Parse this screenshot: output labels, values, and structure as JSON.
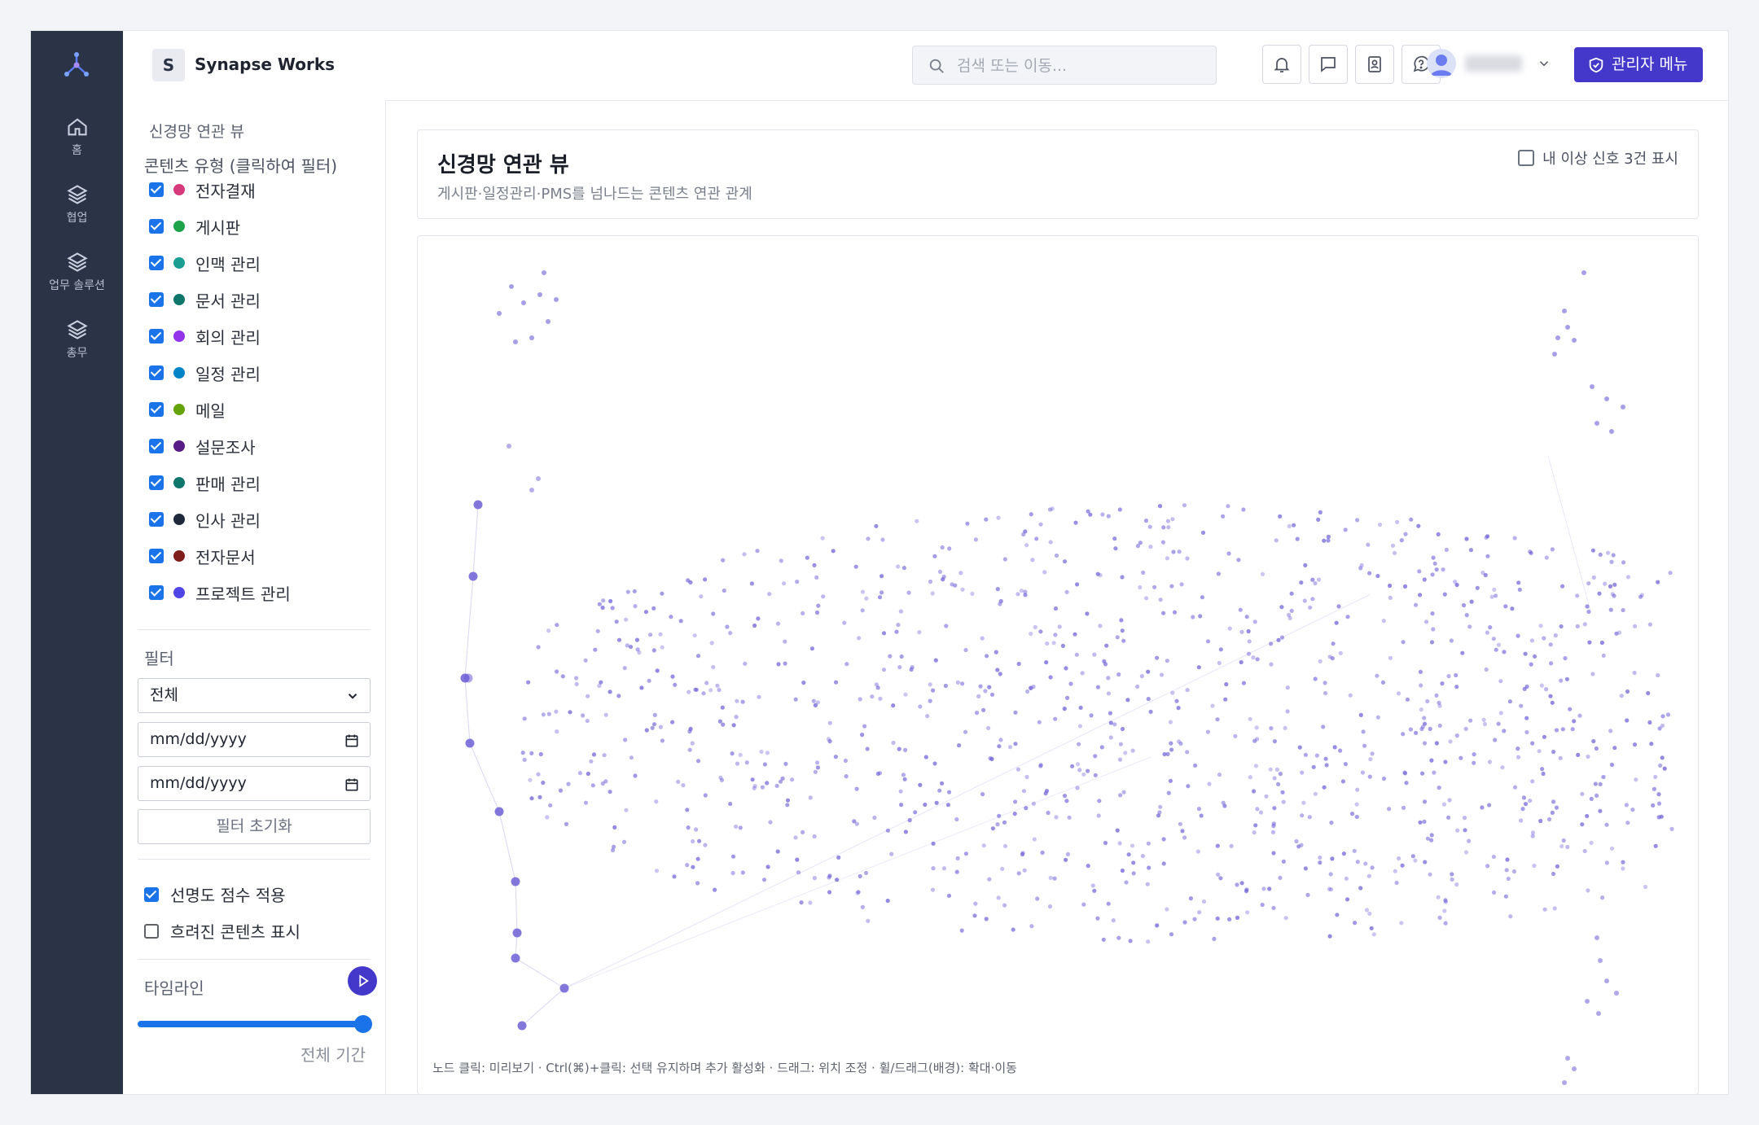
{
  "app": {
    "brand_initial": "S",
    "brand_name": "Synapse Works"
  },
  "rail": {
    "items": [
      {
        "label": "홈",
        "icon": "home-icon"
      },
      {
        "label": "협업",
        "icon": "layers-icon"
      },
      {
        "label": "업무 솔루션",
        "icon": "layers-icon"
      },
      {
        "label": "총무",
        "icon": "layers-icon"
      }
    ]
  },
  "topbar": {
    "search_placeholder": "검색 또는 이동...",
    "icons": [
      "bell-icon",
      "chat-icon",
      "contacts-icon",
      "help-icon"
    ],
    "admin_label": "관리자 메뉴"
  },
  "sidebar": {
    "title": "신경망 연관 뷰",
    "content_types_label": "콘텐츠 유형 (클릭하여 필터)",
    "content_types": [
      {
        "label": "전자결재",
        "color": "#d63a7a",
        "checked": true
      },
      {
        "label": "게시판",
        "color": "#1fa34a",
        "checked": true
      },
      {
        "label": "인맥 관리",
        "color": "#1a9e92",
        "checked": true
      },
      {
        "label": "문서 관리",
        "color": "#0f766e",
        "checked": true
      },
      {
        "label": "회의 관리",
        "color": "#9333ea",
        "checked": true
      },
      {
        "label": "일정 관리",
        "color": "#0284c7",
        "checked": true
      },
      {
        "label": "메일",
        "color": "#65a30d",
        "checked": true
      },
      {
        "label": "설문조사",
        "color": "#581c87",
        "checked": true
      },
      {
        "label": "판매 관리",
        "color": "#0f766e",
        "checked": true
      },
      {
        "label": "인사 관리",
        "color": "#1e293b",
        "checked": true
      },
      {
        "label": "전자문서",
        "color": "#7f1d1d",
        "checked": true
      },
      {
        "label": "프로젝트 관리",
        "color": "#4f46e5",
        "checked": true
      }
    ],
    "filter_label": "필터",
    "filter_select_value": "전체",
    "date_from": "mm/dd/yyyy",
    "date_to": "mm/dd/yyyy",
    "reset_label": "필터 초기화",
    "option_clarity": {
      "label": "선명도 점수 적용",
      "checked": true
    },
    "option_blurred": {
      "label": "흐려진 콘텐츠 표시",
      "checked": false
    },
    "timeline_label": "타임라인",
    "timeline_value": 1.0,
    "timeline_range_label": "전체 기간"
  },
  "header_card": {
    "title": "신경망 연관 뷰",
    "subtitle": "게시판·일정관리·PMS를 넘나드는 콘텐츠 연관 관계",
    "signal_option": {
      "label": "내 이상 신호 3건 표시",
      "checked": false
    }
  },
  "graph": {
    "hint": "노드 클릭: 미리보기 · Ctrl(⌘)+클릭: 선택 유지하며 추가 활성화 · 드래그: 위치 조정 · 휠/드래그(배경): 확대·이동",
    "node_color": "#6d5fd6",
    "edge_color": "#c9c4ee"
  }
}
